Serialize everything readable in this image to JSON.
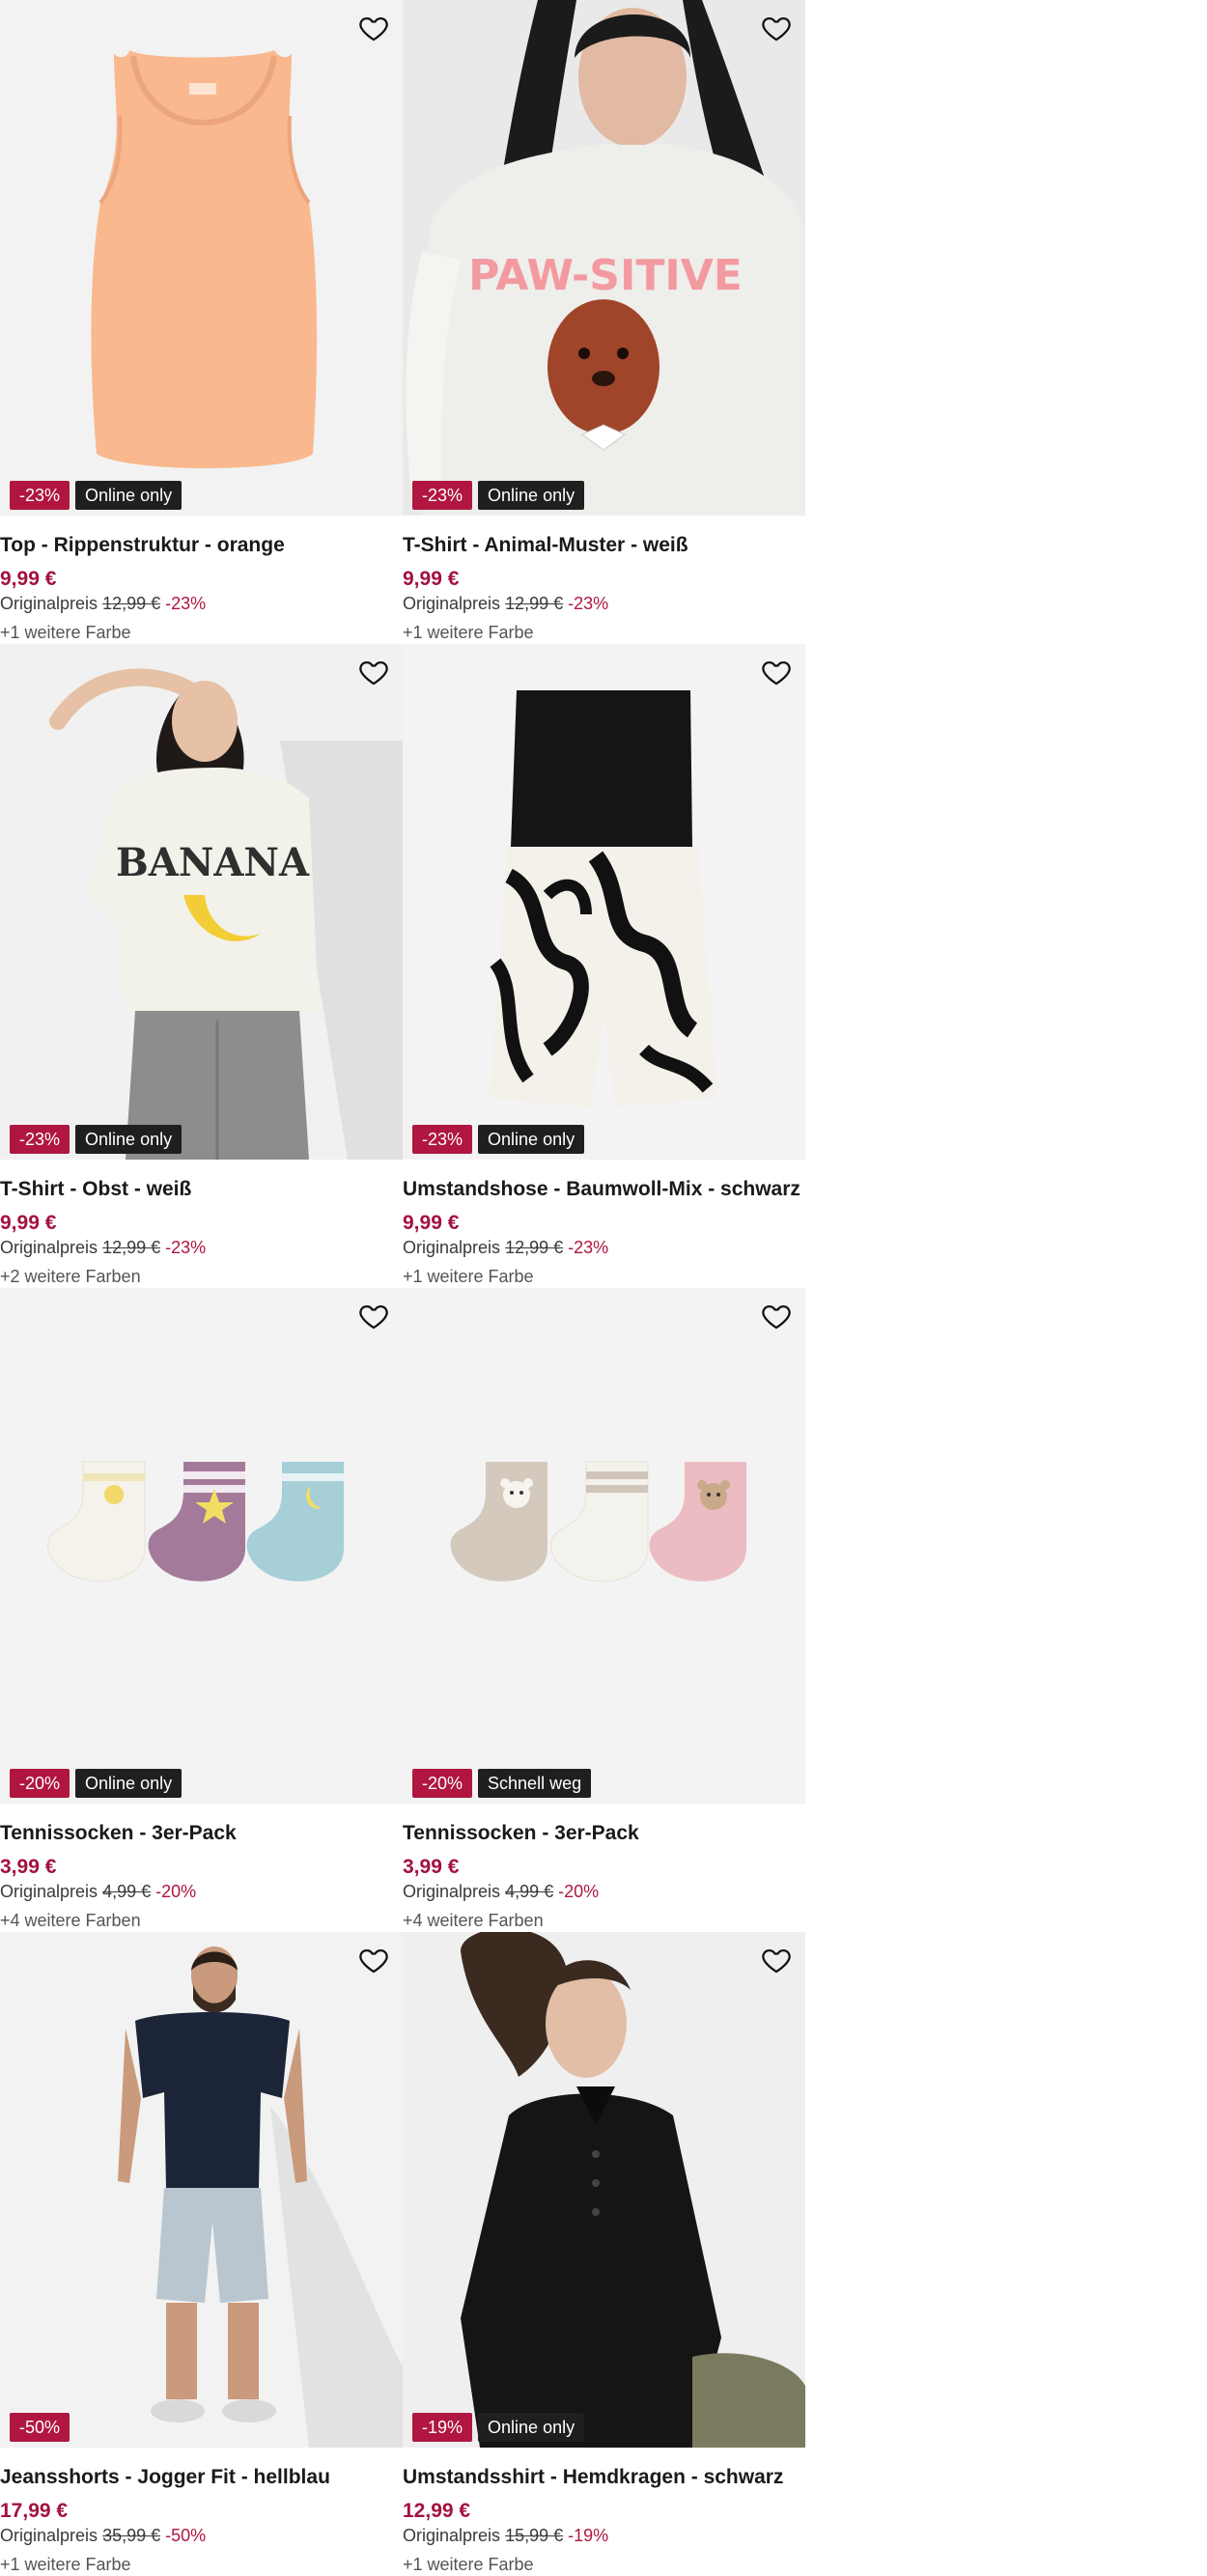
{
  "products": [
    {
      "title": "Top - Rippenstruktur - orange",
      "price": "9,99 €",
      "original_label": "Originalpreis",
      "original_price": "12,99 €",
      "discount": "-23%",
      "badge_discount": "-23%",
      "badge_tag": "Online only",
      "colors": "+1 weitere Farbe"
    },
    {
      "title": "T-Shirt - Animal-Muster - weiß",
      "price": "9,99 €",
      "original_label": "Originalpreis",
      "original_price": "12,99 €",
      "discount": "-23%",
      "badge_discount": "-23%",
      "badge_tag": "Online only",
      "colors": "+1 weitere Farbe",
      "print_text": "PAW-SITIVE"
    },
    {
      "title": "T-Shirt - Obst - weiß",
      "price": "9,99 €",
      "original_label": "Originalpreis",
      "original_price": "12,99 €",
      "discount": "-23%",
      "badge_discount": "-23%",
      "badge_tag": "Online only",
      "colors": "+2 weitere Farben",
      "print_text": "BANANA"
    },
    {
      "title": "Umstandshose - Baumwoll-Mix - schwarz",
      "price": "9,99 €",
      "original_label": "Originalpreis",
      "original_price": "12,99 €",
      "discount": "-23%",
      "badge_discount": "-23%",
      "badge_tag": "Online only",
      "colors": "+1 weitere Farbe"
    },
    {
      "title": "Tennissocken - 3er-Pack",
      "price": "3,99 €",
      "original_label": "Originalpreis",
      "original_price": "4,99 €",
      "discount": "-20%",
      "badge_discount": "-20%",
      "badge_tag": "Online only",
      "colors": "+4 weitere Farben"
    },
    {
      "title": "Tennissocken - 3er-Pack",
      "price": "3,99 €",
      "original_label": "Originalpreis",
      "original_price": "4,99 €",
      "discount": "-20%",
      "badge_discount": "-20%",
      "badge_tag": "Schnell weg",
      "colors": "+4 weitere Farben"
    },
    {
      "title": "Jeansshorts - Jogger Fit - hellblau",
      "price": "17,99 €",
      "original_label": "Originalpreis",
      "original_price": "35,99 €",
      "discount": "-50%",
      "badge_discount": "-50%",
      "colors": "+1 weitere Farbe"
    },
    {
      "title": "Umstandsshirt - Hemdkragen - schwarz",
      "price": "12,99 €",
      "original_label": "Originalpreis",
      "original_price": "15,99 €",
      "discount": "-19%",
      "badge_discount": "-19%",
      "badge_tag": "Online only",
      "colors": "+1 weitere Farbe"
    }
  ],
  "icons": {
    "favorite": "heart-outline-icon"
  },
  "colors": {
    "price": "#a3123e",
    "discount_badge": "#b01640",
    "tag_badge": "#1f1f1f",
    "image_bg": "#f3f3f3"
  }
}
